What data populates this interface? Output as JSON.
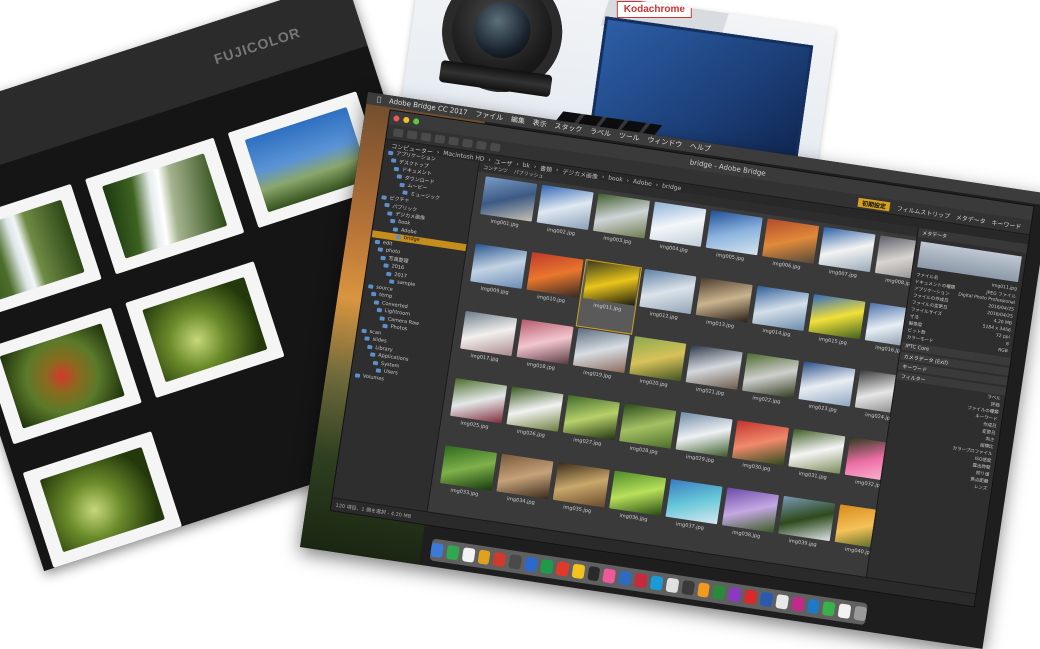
{
  "lens_photo": {
    "box_label": "Kodachrome"
  },
  "film_sheet": {
    "brand_label": "FUJICOLOR"
  },
  "bridge": {
    "menubar": [
      "Adobe Bridge CC 2017",
      "ファイル",
      "編集",
      "表示",
      "スタック",
      "ラベル",
      "ツール",
      "ウィンドウ",
      "ヘルプ"
    ],
    "window_title": "bridge - Adobe Bridge",
    "toolbar": {
      "essentials": "初期設定",
      "workspaces": [
        "フィルムストリップ",
        "メタデータ",
        "キーワード"
      ]
    },
    "path": [
      "コンピューター",
      "Macintosh HD",
      "ユーザ",
      "bk",
      "書類",
      "デジカメ画像",
      "book",
      "Adobe",
      "bridge"
    ],
    "content_tabs": [
      "コンテンツ",
      "パブリッシュ"
    ],
    "folders": [
      "アプリケーション",
      "デスクトップ",
      "ドキュメント",
      "ダウンロード",
      "ムービー",
      "ミュージック",
      "ピクチャ",
      "パブリック",
      "デジカメ画像",
      "book",
      "Adobe",
      "bridge",
      "edit",
      "photo",
      "写真整理",
      "2016",
      "2017",
      "sample",
      "source",
      "temp",
      "Converted",
      "Lightroom",
      "Camera Raw",
      "Photos",
      "scan",
      "slides",
      "Library",
      "Applications",
      "System",
      "Users",
      "Volumes"
    ],
    "thumbnails": [
      {
        "label": "img001.jpg",
        "colors": [
          "#7b9cc9",
          "#3c5a84",
          "#c8c2b4"
        ]
      },
      {
        "label": "img002.jpg",
        "colors": [
          "#2f66b3",
          "#dfe8f2",
          "#8aa0b6"
        ]
      },
      {
        "label": "img003.jpg",
        "colors": [
          "#3e5a2a",
          "#cfd5d8",
          "#6e7c4d"
        ]
      },
      {
        "label": "img004.jpg",
        "colors": [
          "#8eb2d8",
          "#f4f7fa",
          "#c0cdd8"
        ]
      },
      {
        "label": "img005.jpg",
        "colors": [
          "#1e4f96",
          "#8bb3df",
          "#d8e4ef"
        ]
      },
      {
        "label": "img006.jpg",
        "colors": [
          "#b24b2a",
          "#e08a3a",
          "#54483c"
        ]
      },
      {
        "label": "img007.jpg",
        "colors": [
          "#2a5fa6",
          "#f3f3f3",
          "#97a9b6"
        ]
      },
      {
        "label": "img008.jpg",
        "colors": [
          "#5c5f6a",
          "#d9d4d0",
          "#8b8b8b"
        ]
      },
      {
        "label": "img009.jpg",
        "colors": [
          "#27548f",
          "#c3d3e4",
          "#6b8cb5"
        ]
      },
      {
        "label": "img010.jpg",
        "colors": [
          "#c0392b",
          "#e9772d",
          "#3a2a24"
        ]
      },
      {
        "label": "img011.jpg",
        "colors": [
          "#3b3a1c",
          "#e8c51a",
          "#1d1c10"
        ]
      },
      {
        "label": "img012.jpg",
        "colors": [
          "#5f7fa6",
          "#dbe3ea",
          "#93a4b6"
        ]
      },
      {
        "label": "img013.jpg",
        "colors": [
          "#4c3a2c",
          "#c9b48f",
          "#2a1e16"
        ]
      },
      {
        "label": "img014.jpg",
        "colors": [
          "#2e5e9c",
          "#d3dfe9",
          "#6c8aa9"
        ]
      },
      {
        "label": "img015.jpg",
        "colors": [
          "#2f6ac0",
          "#f1e03a",
          "#3d5f1e"
        ]
      },
      {
        "label": "img016.jpg",
        "colors": [
          "#4b6fa8",
          "#e7eef5",
          "#7d8f9f"
        ]
      },
      {
        "label": "img017.jpg",
        "colors": [
          "#6a7a88",
          "#f2f0ee",
          "#a98a8a"
        ]
      },
      {
        "label": "img018.jpg",
        "colors": [
          "#b65a6c",
          "#f2c6cf",
          "#5a3a42"
        ]
      },
      {
        "label": "img019.jpg",
        "colors": [
          "#5a6a7c",
          "#d7dde3",
          "#8c6a5a"
        ]
      },
      {
        "label": "img020.jpg",
        "colors": [
          "#8aa94f",
          "#d8c25a",
          "#3e5220"
        ]
      },
      {
        "label": "img021.jpg",
        "colors": [
          "#2a3648",
          "#d4d8dc",
          "#6d5a4a"
        ]
      },
      {
        "label": "img022.jpg",
        "colors": [
          "#4c6a2c",
          "#cfcfcf",
          "#2e3a1c"
        ]
      },
      {
        "label": "img023.jpg",
        "colors": [
          "#2b4f8a",
          "#e9eef3",
          "#8ea7c2"
        ]
      },
      {
        "label": "img024.jpg",
        "colors": [
          "#3a3a3a",
          "#e6e6e6",
          "#7c7c7c"
        ]
      },
      {
        "label": "img025.jpg",
        "colors": [
          "#4a6c2a",
          "#e4e8e8",
          "#7f2b3a"
        ]
      },
      {
        "label": "img026.jpg",
        "colors": [
          "#3a5a20",
          "#f2f2f2",
          "#6b7d3a"
        ]
      },
      {
        "label": "img027.jpg",
        "colors": [
          "#3e6a2a",
          "#b7d06b",
          "#1e3410"
        ]
      },
      {
        "label": "img028.jpg",
        "colors": [
          "#2a4a1c",
          "#a5c063",
          "#4d6d2a"
        ]
      },
      {
        "label": "img029.jpg",
        "colors": [
          "#6f8aa6",
          "#eef1f3",
          "#3c5a2a"
        ]
      },
      {
        "label": "img030.jpg",
        "colors": [
          "#c3322c",
          "#f08a6c",
          "#2a4a1c"
        ]
      },
      {
        "label": "img031.jpg",
        "colors": [
          "#3a5a20",
          "#f5f5f5",
          "#7a8a5a"
        ]
      },
      {
        "label": "img032.jpg",
        "colors": [
          "#2a3a1c",
          "#ee6fa6",
          "#f9c3d8"
        ]
      },
      {
        "label": "img033.jpg",
        "colors": [
          "#2e6a1e",
          "#7fb04a",
          "#153a0c"
        ]
      },
      {
        "label": "img034.jpg",
        "colors": [
          "#7a5a3a",
          "#c6a27a",
          "#3a2a1a"
        ]
      },
      {
        "label": "img035.jpg",
        "colors": [
          "#3a2a1a",
          "#c9a86b",
          "#6a4a2a"
        ]
      },
      {
        "label": "img036.jpg",
        "colors": [
          "#4c8a2a",
          "#b8e05a",
          "#264a12"
        ]
      },
      {
        "label": "img037.jpg",
        "colors": [
          "#3a7ac0",
          "#66c8d8",
          "#d7e8ef"
        ]
      },
      {
        "label": "img038.jpg",
        "colors": [
          "#6a4aa6",
          "#c4a8e4",
          "#3a5a20"
        ]
      },
      {
        "label": "img039.jpg",
        "colors": [
          "#7a9ab6",
          "#2e4a1c",
          "#dfe6ea"
        ]
      },
      {
        "label": "img040.jpg",
        "colors": [
          "#d88a1a",
          "#f5c25a",
          "#3e5a1c"
        ]
      }
    ],
    "metadata_panel": {
      "header": "メタデータ",
      "rows": [
        [
          "ファイル名",
          "img011.jpg"
        ],
        [
          "ドキュメントの種類",
          "JPEG ファイル"
        ],
        [
          "アプリケーション",
          "Digital Photo Professional"
        ],
        [
          "ファイルの作成日",
          "2016/04/25"
        ],
        [
          "ファイルの変更日",
          "2016/04/25"
        ],
        [
          "ファイルサイズ",
          "4.20 MB"
        ],
        [
          "寸法",
          "5184 x 3456"
        ],
        [
          "解像度",
          "72 ppi"
        ],
        [
          "ビット数",
          "8"
        ],
        [
          "カラーモード",
          "RGB"
        ]
      ],
      "sections": [
        "IPTC Core",
        "カメラデータ (Exif)",
        "キーワード",
        "フィルター"
      ],
      "filter_rows": [
        "ラベル",
        "評価",
        "ファイルの種類",
        "キーワード",
        "作成日",
        "変更日",
        "向き",
        "縦横比",
        "カラープロファイル",
        "ISO感度",
        "露出時間",
        "絞り値",
        "焦点距離",
        "レンズ"
      ]
    },
    "status_text": "120 項目、1 個を選択 - 4.20 MB"
  },
  "dock_colors": [
    "#3c7ad8",
    "#2fa84f",
    "#f2f2f2",
    "#e0a21e",
    "#d03a2c",
    "#4a4a4a",
    "#2a6ad0",
    "#1e9a4a",
    "#e23a2a",
    "#f2c21e",
    "#2a2a2a",
    "#ec5a9c",
    "#2e6ac0",
    "#c72a3a",
    "#1c9ad8",
    "#e0e0e0",
    "#3a3a3a",
    "#f29a1e",
    "#2a8a3a",
    "#8a3ac0",
    "#d82a2a",
    "#2a5ab0",
    "#e8e8e8",
    "#c22a8a",
    "#1e7ac8",
    "#3ab04a",
    "#f2f2f2",
    "#9a9a9a"
  ]
}
